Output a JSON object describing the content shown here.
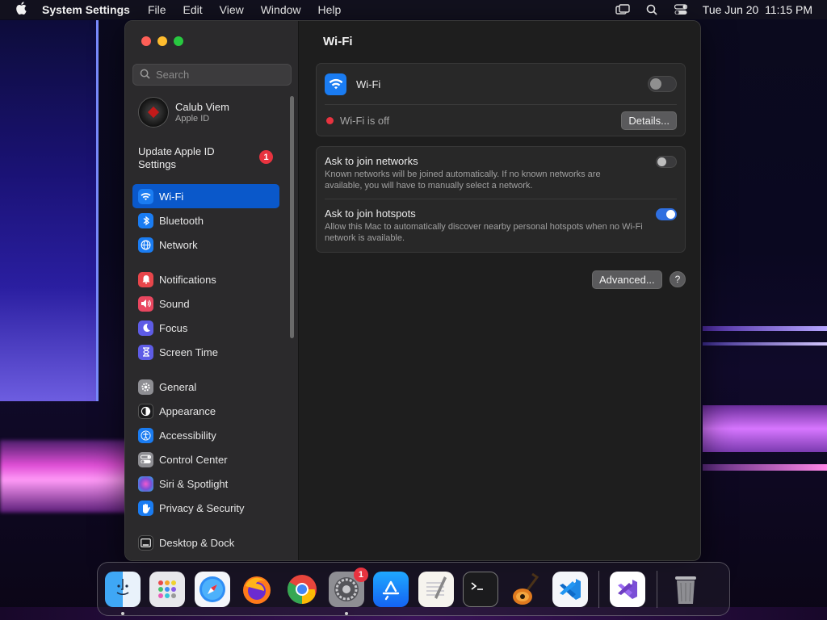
{
  "menubar": {
    "app_name": "System Settings",
    "menus": [
      "File",
      "Edit",
      "View",
      "Window",
      "Help"
    ],
    "datetime": "Tue Jun 20  11:15 PM"
  },
  "sidebar": {
    "search_placeholder": "Search",
    "account": {
      "name": "Calub Viem",
      "subtitle": "Apple ID"
    },
    "update": {
      "label": "Update Apple ID Settings",
      "badge": "1"
    },
    "groups": [
      [
        {
          "label": "Wi-Fi",
          "icon": "wifi-icon",
          "color": "#1a7cf2",
          "active": true
        },
        {
          "label": "Bluetooth",
          "icon": "bluetooth-icon",
          "color": "#1a7cf2"
        },
        {
          "label": "Network",
          "icon": "globe-icon",
          "color": "#1a7cf2"
        }
      ],
      [
        {
          "label": "Notifications",
          "icon": "bell-icon",
          "color": "#e8464b"
        },
        {
          "label": "Sound",
          "icon": "speaker-icon",
          "color": "#e8465f"
        },
        {
          "label": "Focus",
          "icon": "moon-icon",
          "color": "#5e5ce6"
        },
        {
          "label": "Screen Time",
          "icon": "hourglass-icon",
          "color": "#5e5ce6"
        }
      ],
      [
        {
          "label": "General",
          "icon": "gear-icon",
          "color": "#8e8e93"
        },
        {
          "label": "Appearance",
          "icon": "appearance-icon",
          "color": "#1c1c1e"
        },
        {
          "label": "Accessibility",
          "icon": "accessibility-icon",
          "color": "#1a7cf2"
        },
        {
          "label": "Control Center",
          "icon": "control-center-icon",
          "color": "#8e8e93"
        },
        {
          "label": "Siri & Spotlight",
          "icon": "siri-icon",
          "color": "#7b4fd6"
        },
        {
          "label": "Privacy & Security",
          "icon": "hand-icon",
          "color": "#1a7cf2"
        }
      ],
      [
        {
          "label": "Desktop & Dock",
          "icon": "dock-icon",
          "color": "#1c1c1e"
        }
      ]
    ]
  },
  "content": {
    "title": "Wi-Fi",
    "wifi_row": {
      "label": "Wi-Fi",
      "enabled": false
    },
    "status": {
      "text": "Wi-Fi is off",
      "dot_color": "#e8333f",
      "details_button": "Details..."
    },
    "options": [
      {
        "title": "Ask to join networks",
        "description": "Known networks will be joined automatically. If no known networks are available, you will have to manually select a network.",
        "enabled": false
      },
      {
        "title": "Ask to join hotspots",
        "description": "Allow this Mac to automatically discover nearby personal hotspots when no Wi-Fi network is available.",
        "enabled": true
      }
    ],
    "advanced_button": "Advanced...",
    "help_button": "?"
  },
  "dock": {
    "apps": [
      {
        "name": "Finder",
        "icon": "finder-icon",
        "running": true
      },
      {
        "name": "Launchpad",
        "icon": "launchpad-icon"
      },
      {
        "name": "Safari",
        "icon": "safari-icon"
      },
      {
        "name": "Firefox",
        "icon": "firefox-icon"
      },
      {
        "name": "Chrome",
        "icon": "chrome-icon"
      },
      {
        "name": "System Settings",
        "icon": "system-settings-icon",
        "running": true,
        "badge": "1"
      },
      {
        "name": "App Store",
        "icon": "app-store-icon"
      },
      {
        "name": "TextEdit",
        "icon": "textedit-icon"
      },
      {
        "name": "Terminal",
        "icon": "terminal-icon"
      },
      {
        "name": "GarageBand",
        "icon": "garageband-icon"
      },
      {
        "name": "Visual Studio Code",
        "icon": "vscode-icon"
      }
    ],
    "extra": [
      {
        "name": "Visual Studio",
        "icon": "visual-studio-icon"
      },
      {
        "name": "Trash",
        "icon": "trash-icon"
      }
    ]
  }
}
